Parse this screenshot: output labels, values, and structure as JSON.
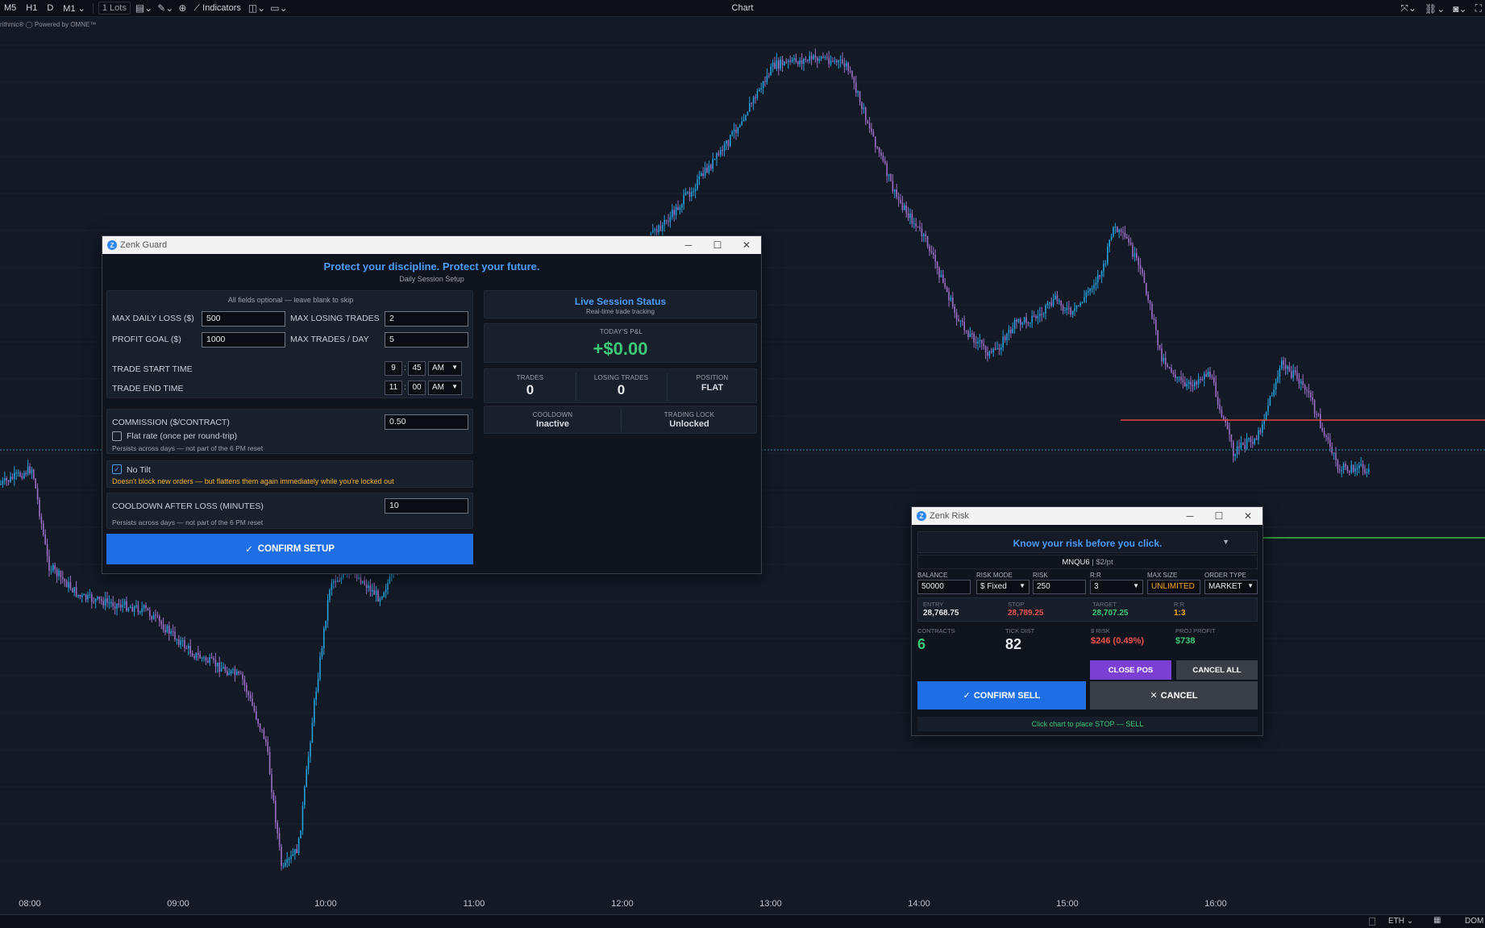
{
  "toolbar": {
    "timeframes": [
      "M5",
      "H1",
      "D",
      "M1"
    ],
    "lots": "1 Lots",
    "indicators": "Indicators",
    "title": "Chart"
  },
  "powered_by": "rithmic® ◯ Powered by OMNE™",
  "chart": {
    "time_labels": [
      "08:00",
      "09:00",
      "10:00",
      "11:00",
      "12:00",
      "13:00",
      "14:00",
      "15:00",
      "16:00"
    ],
    "bottom": {
      "session": "ETH",
      "dom": "DOM"
    },
    "colors": {
      "bull": "#26a0da",
      "bear": "#9b6fc5",
      "red_line": "#e0453b",
      "green_line": "#3fb94a",
      "dotted": "#2d8ab5"
    }
  },
  "guard": {
    "window_title": "Zenk Guard",
    "headline": "Protect your discipline. Protect your future.",
    "subheadline": "Daily Session Setup",
    "optional_note": "All fields optional — leave blank to skip",
    "max_daily_loss_label": "MAX DAILY LOSS ($)",
    "max_daily_loss": "500",
    "max_losing_trades_label": "MAX LOSING TRADES",
    "max_losing_trades": "2",
    "profit_goal_label": "PROFIT GOAL ($)",
    "profit_goal": "1000",
    "max_trades_label": "MAX TRADES / DAY",
    "max_trades": "5",
    "start_time_label": "TRADE START TIME",
    "start_hour": "9",
    "start_min": "45",
    "start_ampm": "AM",
    "end_time_label": "TRADE END TIME",
    "end_hour": "11",
    "end_min": "00",
    "end_ampm": "AM",
    "commission_label": "COMMISSION ($/CONTRACT)",
    "commission": "0.50",
    "flat_rate_label": "Flat rate (once per round-trip)",
    "persists_note": "Persists across days — not part of the 6 PM reset",
    "no_tilt_label": "No Tilt",
    "no_tilt_warning": "Doesn't block new orders — but flattens them again immediately while you're locked out",
    "cooldown_label": "COOLDOWN AFTER LOSS (MINUTES)",
    "cooldown": "10",
    "cooldown_note": "Persists across days — not part of the 6 PM reset",
    "confirm_label": "CONFIRM SETUP",
    "status": {
      "title": "Live Session Status",
      "subtitle": "Real-time trade tracking",
      "pnl_label": "TODAY'S P&L",
      "pnl": "+$0.00",
      "trades_label": "TRADES",
      "trades": "0",
      "losing_label": "LOSING TRADES",
      "losing": "0",
      "position_label": "POSITION",
      "position": "FLAT",
      "cooldown_label": "COOLDOWN",
      "cooldown": "Inactive",
      "lock_label": "TRADING LOCK",
      "lock": "Unlocked"
    }
  },
  "risk": {
    "window_title": "Zenk Risk",
    "headline": "Know your risk before you click.",
    "symbol": "MNQU6",
    "per_point": "$2/pt",
    "balance_label": "BALANCE",
    "balance": "50000",
    "risk_mode_label": "RISK MODE",
    "risk_mode": "$ Fixed",
    "risk_label": "RISK",
    "risk": "250",
    "rr_label": "R:R",
    "rr": "3",
    "max_size_label": "MAX SIZE",
    "max_size": "UNLIMITED",
    "order_type_label": "ORDER TYPE",
    "order_type": "MARKET",
    "entry_label": "ENTRY",
    "entry": "28,768.75",
    "stop_label": "STOP",
    "stop": "28,789.25",
    "target_label": "TARGET",
    "target": "28,707.25",
    "rr2_label": "R:R",
    "rr2": "1:3",
    "contracts_label": "CONTRACTS",
    "contracts": "6",
    "tick_dist_label": "TICK DIST",
    "tick_dist": "82",
    "dollar_risk_label": "$ RISK",
    "dollar_risk": "$246 (0.49%)",
    "proj_profit_label": "PROJ PROFIT",
    "proj_profit": "$738",
    "close_pos": "CLOSE POS",
    "cancel_all": "CANCEL ALL",
    "confirm_sell": "CONFIRM SELL",
    "cancel": "CANCEL",
    "hint": "Click chart to place STOP — SELL"
  }
}
